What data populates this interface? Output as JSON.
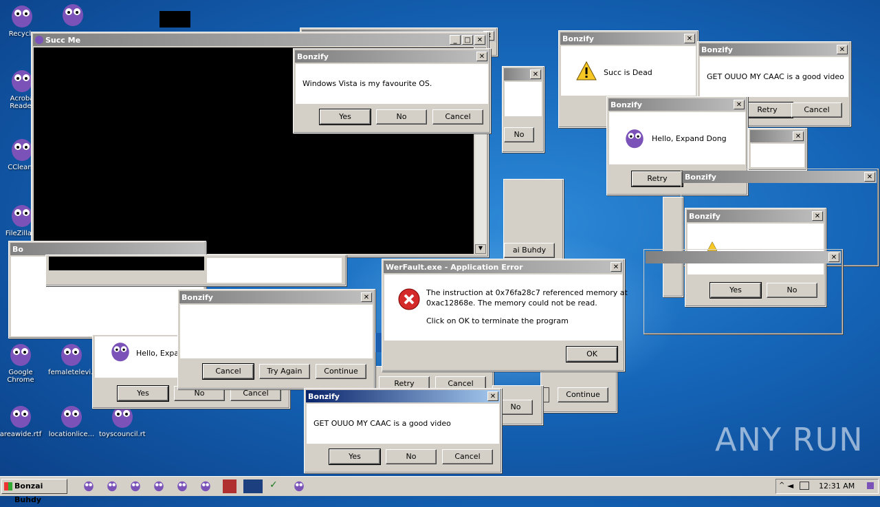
{
  "desktop_icons": [
    {
      "label": "Recycle"
    },
    {
      "label": "Acroba\nReader"
    },
    {
      "label": "CCleane"
    },
    {
      "label": "FileZilla C"
    },
    {
      "label": "Google\nChrome"
    },
    {
      "label": "femaletelevi..."
    },
    {
      "label": "areawide.rtf"
    },
    {
      "label": "locationlice..."
    },
    {
      "label": "toyscouncil.rtf"
    }
  ],
  "succ_window": {
    "title": "Succ Me"
  },
  "w_vista": {
    "title": "Bonzify",
    "message": "Windows Vista is my favourite OS.",
    "buttons": [
      "Yes",
      "No",
      "Cancel"
    ]
  },
  "w_succdead": {
    "title": "Bonzify",
    "message": "Succ is Dead"
  },
  "w_ouuo_top": {
    "title": "Bonzify",
    "message": "GET OUUO MY CAAC is a good video",
    "buttons": [
      "Retry",
      "Cancel"
    ]
  },
  "w_hello": {
    "title": "Bonzify",
    "message": "Hello, Expand Dong",
    "buttons": [
      "Retry"
    ]
  },
  "w_bonzify_right1": {
    "title": "Bonzify"
  },
  "w_bonzify_right2": {
    "title": "Bonzify",
    "buttons": [
      "Yes",
      "No"
    ]
  },
  "w_back_no": {
    "buttons": [
      "No"
    ]
  },
  "w_buhdy": {
    "text": "ai Buhdy"
  },
  "w_left_hello": {
    "message": "Hello, Expan",
    "buttons": [
      "Yes",
      "No",
      "Cancel"
    ]
  },
  "w_tryagain": {
    "title": "Bonzify",
    "buttons": [
      "Cancel",
      "Try Again",
      "Continue"
    ]
  },
  "w_werfault": {
    "title": "WerFault.exe - Application Error",
    "line1": "The instruction at 0x76fa28c7 referenced memory at",
    "line2": "0xac12868e. The memory could not be read.",
    "line3": "Click on OK to terminate the program",
    "ok": "OK"
  },
  "w_retry_cancel": {
    "buttons": [
      "Retry",
      "Cancel"
    ]
  },
  "w_continue": {
    "buttons": [
      "Continue"
    ]
  },
  "w_no_small": {
    "buttons": [
      "No"
    ]
  },
  "w_ouuo_bottom": {
    "title": "Bonzify",
    "message": "GET OUUO MY CAAC is a good video",
    "buttons": [
      "Yes",
      "No",
      "Cancel"
    ]
  },
  "w_left_partial": {
    "title": "Bo"
  },
  "taskbar": {
    "start_label": "Bonzai Buhdy",
    "clock": "12:31 AM"
  },
  "watermark": "ANY RUN",
  "colors": {
    "accent": "#0a246a",
    "desktop": "#1565b8",
    "purple": "#7b52b8"
  }
}
